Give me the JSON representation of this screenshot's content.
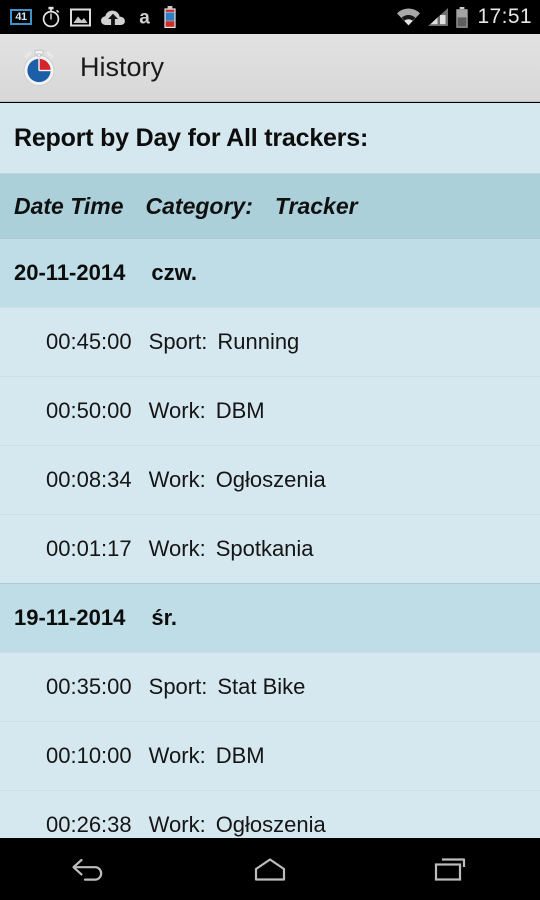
{
  "status_bar": {
    "time": "17:51",
    "left_icons": [
      {
        "name": "notification-count-badge-icon",
        "label": "41"
      },
      {
        "name": "stopwatch-icon",
        "label": ""
      },
      {
        "name": "image-icon",
        "label": ""
      },
      {
        "name": "cloud-upload-icon",
        "label": ""
      },
      {
        "name": "letter-a-icon",
        "label": "a"
      },
      {
        "name": "battery-status-icon",
        "label": ""
      }
    ],
    "right_icons": [
      {
        "name": "wifi-icon"
      },
      {
        "name": "cellular-signal-icon"
      },
      {
        "name": "battery-icon"
      }
    ]
  },
  "app_bar": {
    "icon": "stopwatch-app-icon",
    "title": "History"
  },
  "report": {
    "title": "Report by Day for All trackers:",
    "columns": [
      "Date Time",
      "Category:",
      "Tracker"
    ],
    "groups": [
      {
        "date": "20-11-2014",
        "weekday": "czw.",
        "entries": [
          {
            "duration": "00:45:00",
            "category": "Sport:",
            "tracker": "Running"
          },
          {
            "duration": "00:50:00",
            "category": "Work:",
            "tracker": "DBM"
          },
          {
            "duration": "00:08:34",
            "category": "Work:",
            "tracker": "Ogłoszenia"
          },
          {
            "duration": "00:01:17",
            "category": "Work:",
            "tracker": "Spotkania"
          }
        ]
      },
      {
        "date": "19-11-2014",
        "weekday": "śr.",
        "entries": [
          {
            "duration": "00:35:00",
            "category": "Sport:",
            "tracker": "Stat Bike"
          },
          {
            "duration": "00:10:00",
            "category": "Work:",
            "tracker": "DBM"
          },
          {
            "duration": "00:26:38",
            "category": "Work:",
            "tracker": "Ogłoszenia"
          }
        ]
      }
    ]
  },
  "nav_bar": {
    "buttons": [
      {
        "name": "back-button",
        "label": "Back"
      },
      {
        "name": "home-button",
        "label": "Home"
      },
      {
        "name": "recents-button",
        "label": "Recents"
      }
    ]
  },
  "colors": {
    "status_bar_bg": "#000000",
    "app_bar_bg": "#dcdcdc",
    "content_bg": "#d6e8ef",
    "column_header_bg": "#abd0da",
    "day_row_bg": "#bfdde6",
    "accent_blue": "#1a5fa8",
    "accent_red": "#d7232a"
  }
}
